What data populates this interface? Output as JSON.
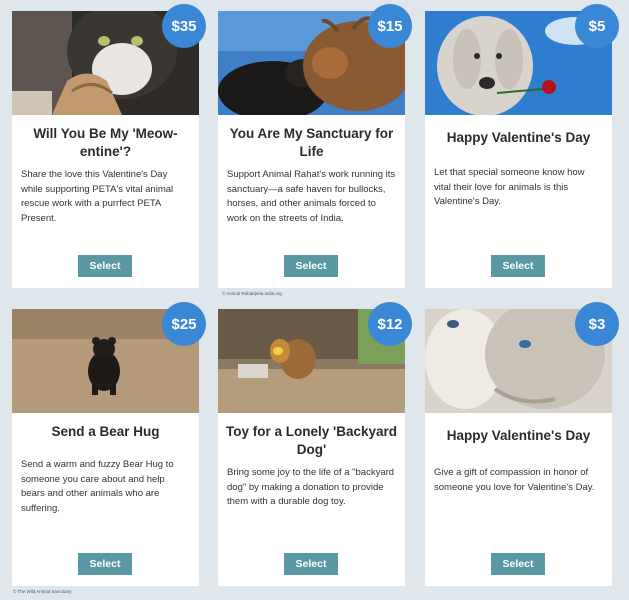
{
  "cards": [
    {
      "price": "$35",
      "title": "Will You Be My 'Meow-entine'?",
      "description": "Share the love this Valentine's Day while supporting PETA's vital animal rescue work with a purrfect PETA Present.",
      "button": "Select",
      "image": "cat-with-heart-cookie"
    },
    {
      "price": "$15",
      "title": "You Are My Sanctuary for Life",
      "description": "Support Animal Rahat's work running its sanctuary—a safe haven for bullocks, horses, and other animals forced to work on the streets of India.",
      "button": "Select",
      "image": "bullocks-nuzzling"
    },
    {
      "price": "$5",
      "title": "Happy Valentine's Day",
      "description": "Let that special someone know how vital their love for animals is this Valentine's Day.",
      "button": "Select",
      "image": "dog-with-rose"
    },
    {
      "price": "$25",
      "title": "Send a Bear Hug",
      "description": "Send a warm and fuzzy Bear Hug to someone you care about and help bears and other animals who are suffering.",
      "button": "Select",
      "image": "bear-cub"
    },
    {
      "price": "$12",
      "title": "Toy for a Lonely 'Backyard Dog'",
      "description": "Bring some joy to the life of a \"backyard dog\" by making a donation to provide them with a durable dog toy.",
      "button": "Select",
      "image": "dogs-playing"
    },
    {
      "price": "$3",
      "title": "Happy Valentine's Day",
      "description": "Give a gift of compassion in honor of someone you love for Valentine's Day.",
      "button": "Select",
      "image": "goats-closeup"
    }
  ],
  "credits": {
    "middle": "© Animal Rahat/peta.india.org",
    "bottom_left": "© The Wild Animal Sanctuary"
  },
  "colors": {
    "price_badge": "#3a87d6",
    "button": "#5a98a4",
    "background": "#dfe7ec"
  }
}
